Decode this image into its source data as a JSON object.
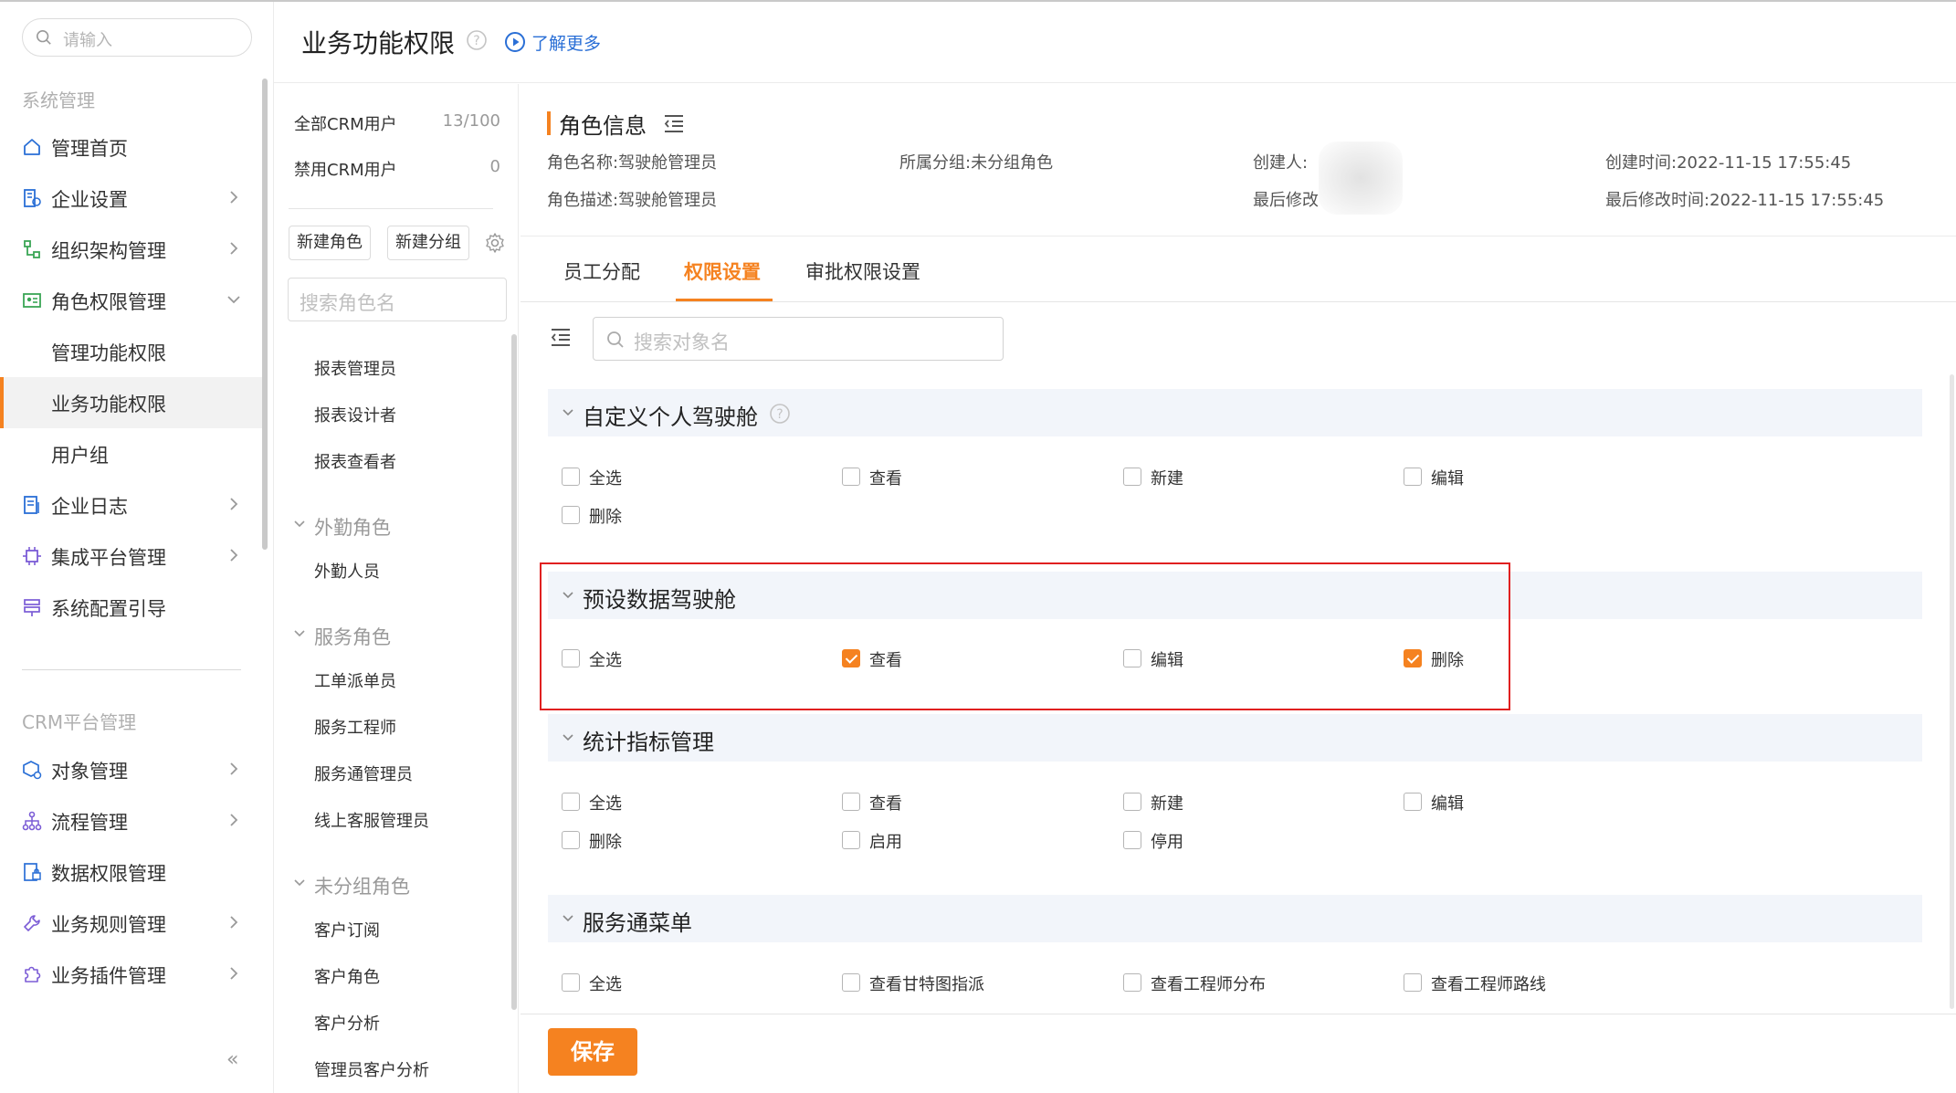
{
  "sidebar": {
    "search_placeholder": "请输入",
    "section_system": "系统管理",
    "items": [
      {
        "label": "管理首页"
      },
      {
        "label": "企业设置"
      },
      {
        "label": "组织架构管理"
      },
      {
        "label": "角色权限管理"
      },
      {
        "label": "管理功能权限"
      },
      {
        "label": "业务功能权限"
      },
      {
        "label": "用户组"
      },
      {
        "label": "企业日志"
      },
      {
        "label": "集成平台管理"
      },
      {
        "label": "系统配置引导"
      }
    ],
    "section_crm": "CRM平台管理",
    "crm_items": [
      {
        "label": "对象管理"
      },
      {
        "label": "流程管理"
      },
      {
        "label": "数据权限管理"
      },
      {
        "label": "业务规则管理"
      },
      {
        "label": "业务插件管理"
      }
    ],
    "collapse_glyph": "«"
  },
  "header": {
    "title": "业务功能权限",
    "learn_more": "了解更多"
  },
  "roles": {
    "all_users_label": "全部CRM用户",
    "all_users_count": "13/100",
    "disabled_label": "禁用CRM用户",
    "disabled_count": "0",
    "new_role": "新建角色",
    "new_group": "新建分组",
    "search_placeholder": "搜索角色名",
    "top_items": [
      "报表管理员",
      "报表设计者",
      "报表查看者"
    ],
    "groups": [
      {
        "name": "外勤角色",
        "items": [
          "外勤人员"
        ]
      },
      {
        "name": "服务角色",
        "items": [
          "工单派单员",
          "服务工程师",
          "服务通管理员",
          "线上客服管理员"
        ]
      },
      {
        "name": "未分组角色",
        "items": [
          "客户订阅",
          "客户角色",
          "客户分析",
          "管理员客户分析"
        ]
      }
    ]
  },
  "role_info": {
    "title": "角色信息",
    "name_label": "角色名称:",
    "name_value": "驾驶舱管理员",
    "group_label": "所属分组:",
    "group_value": "未分组角色",
    "creator_label": "创建人:",
    "created_label": "创建时间:",
    "created_value": "2022-11-15 17:55:45",
    "desc_label": "角色描述:",
    "desc_value": "驾驶舱管理员",
    "modifier_label": "最后修改",
    "modified_label": "最后修改时间:",
    "modified_value": "2022-11-15 17:55:45"
  },
  "tabs": [
    "员工分配",
    "权限设置",
    "审批权限设置"
  ],
  "active_tab": "权限设置",
  "object_search_placeholder": "搜索对象名",
  "sections": [
    {
      "title": "自定义个人驾驶舱",
      "perms": [
        {
          "label": "全选",
          "checked": false
        },
        {
          "label": "查看",
          "checked": false
        },
        {
          "label": "新建",
          "checked": false
        },
        {
          "label": "编辑",
          "checked": false
        },
        {
          "label": "删除",
          "checked": false
        }
      ]
    },
    {
      "title": "预设数据驾驶舱",
      "perms": [
        {
          "label": "全选",
          "checked": false
        },
        {
          "label": "查看",
          "checked": true
        },
        {
          "label": "编辑",
          "checked": false
        },
        {
          "label": "删除",
          "checked": true
        }
      ]
    },
    {
      "title": "统计指标管理",
      "perms": [
        {
          "label": "全选",
          "checked": false
        },
        {
          "label": "查看",
          "checked": false
        },
        {
          "label": "新建",
          "checked": false
        },
        {
          "label": "编辑",
          "checked": false
        },
        {
          "label": "删除",
          "checked": false
        },
        {
          "label": "启用",
          "checked": false
        },
        {
          "label": "停用",
          "checked": false
        }
      ]
    },
    {
      "title": "服务通菜单",
      "perms": [
        {
          "label": "全选",
          "checked": false
        },
        {
          "label": "查看甘特图指派",
          "checked": false
        },
        {
          "label": "查看工程师分布",
          "checked": false
        },
        {
          "label": "查看工程师路线",
          "checked": false
        }
      ]
    }
  ],
  "save_label": "保存",
  "colors": {
    "accent": "#f58220",
    "link": "#2a6fd6",
    "highlight_border": "#e02020",
    "section_bg": "#f2f5fa"
  }
}
